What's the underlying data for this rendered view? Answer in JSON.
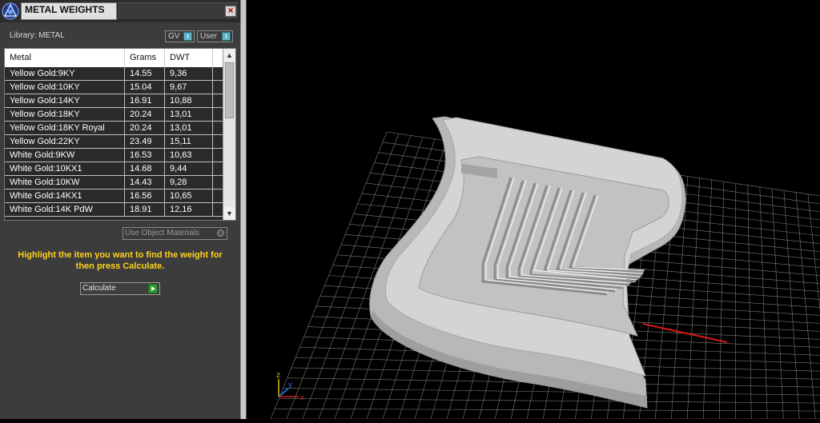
{
  "window": {
    "title": "METAL WEIGHTS",
    "close_glyph": "×"
  },
  "library": {
    "label": "Library: METAL"
  },
  "toggles": [
    {
      "label": "GV"
    },
    {
      "label": "User"
    }
  ],
  "table": {
    "columns": [
      "Metal",
      "Grams",
      "DWT"
    ],
    "rows": [
      [
        "Yellow Gold:9KY",
        "14.55",
        "9,36"
      ],
      [
        "Yellow Gold:10KY",
        "15.04",
        "9,67"
      ],
      [
        "Yellow Gold:14KY",
        "16.91",
        "10,88"
      ],
      [
        "Yellow Gold:18KY",
        "20.24",
        "13,01"
      ],
      [
        "Yellow Gold:18KY Royal",
        "20.24",
        "13,01"
      ],
      [
        "Yellow Gold:22KY",
        "23.49",
        "15,11"
      ],
      [
        "White Gold:9KW",
        "16.53",
        "10,63"
      ],
      [
        "White Gold:10KX1",
        "14.68",
        "9,44"
      ],
      [
        "White Gold:10KW",
        "14.43",
        "9,28"
      ],
      [
        "White Gold:14KX1",
        "16.56",
        "10,65"
      ],
      [
        "White Gold:14K PdW",
        "18.91",
        "12,16"
      ]
    ]
  },
  "use_object_materials": {
    "label": "Use Object Materials",
    "checked": false
  },
  "instructions": "Highlight the item you want to find the weight for then press Calculate.",
  "calculate_button": {
    "label": "Calculate"
  },
  "viewport": {
    "axis_labels": {
      "x": "x",
      "y": "y",
      "z": "z"
    },
    "colors": {
      "model": "#c8c8c8",
      "grid": "#8a8a8a",
      "axis_x": "#d61818",
      "background": "#000000"
    }
  },
  "colors": {
    "panel_bg": "#3c3c3c",
    "instruction_text": "#ffd21a",
    "accent_toggle": "#5fb4c8"
  }
}
